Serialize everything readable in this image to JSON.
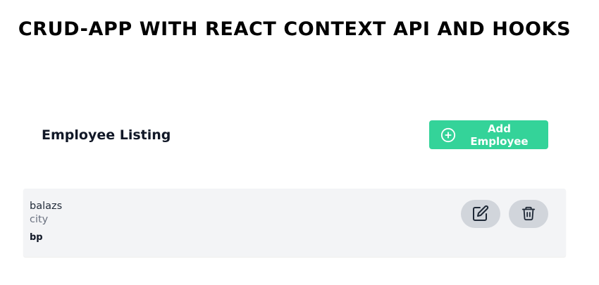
{
  "header": {
    "title": "CRUD-APP WITH REACT CONTEXT API AND HOOKS"
  },
  "listing": {
    "title": "Employee Listing",
    "add_button_label": "Add Employee",
    "add_icon": "plus-circle-icon"
  },
  "employees": [
    {
      "name": "balazs",
      "location": "city",
      "designation": "bp",
      "edit_icon": "edit-icon",
      "delete_icon": "trash-icon"
    }
  ],
  "colors": {
    "accent": "#34d399",
    "card_bg": "#f3f4f6",
    "action_bg": "#d1d5db"
  }
}
